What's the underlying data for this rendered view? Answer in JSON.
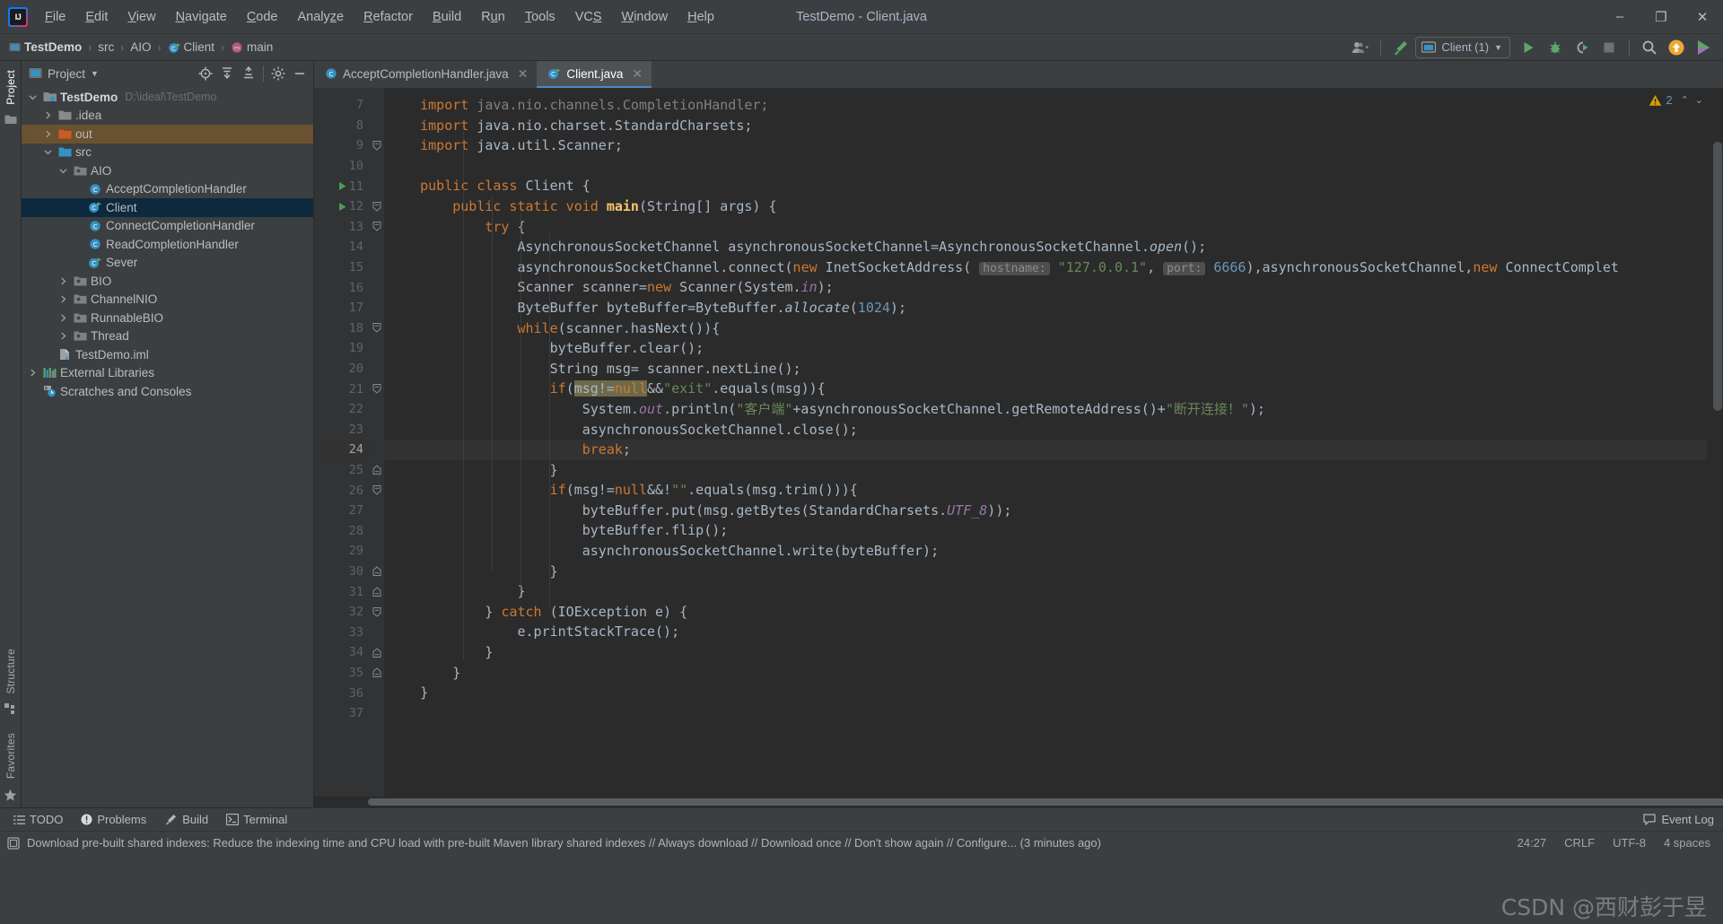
{
  "window": {
    "title": "TestDemo - Client.java",
    "app_icon": "intellij-idea-logo",
    "minimize": "–",
    "maximize": "❐",
    "close": "✕"
  },
  "menubar": [
    {
      "label": "File"
    },
    {
      "label": "Edit"
    },
    {
      "label": "View"
    },
    {
      "label": "Navigate"
    },
    {
      "label": "Code"
    },
    {
      "label": "Analyze"
    },
    {
      "label": "Refactor"
    },
    {
      "label": "Build"
    },
    {
      "label": "Run"
    },
    {
      "label": "Tools"
    },
    {
      "label": "VCS"
    },
    {
      "label": "Window"
    },
    {
      "label": "Help"
    }
  ],
  "breadcrumb": {
    "sep": "›",
    "items": [
      {
        "label": "TestDemo",
        "icon": "project-icon",
        "bold": true
      },
      {
        "label": "src",
        "icon": "folder-icon",
        "bold": false
      },
      {
        "label": "AIO",
        "icon": "package-icon",
        "bold": false
      },
      {
        "label": "Client",
        "icon": "class-icon",
        "bold": false
      },
      {
        "label": "main",
        "icon": "method-icon",
        "bold": false
      }
    ]
  },
  "toolbar": {
    "account_icon": "user-account-icon",
    "build_icon": "build-hammer-icon",
    "run_config": {
      "icon": "run-config-icon",
      "label": "Client (1)",
      "chevron": "▼"
    },
    "run_icon": "run-play-icon",
    "debug_icon": "debug-bug-icon",
    "run_coverage_icon": "run-with-coverage-icon",
    "stop_icon": "stop-square-icon",
    "search_icon": "search-everywhere-icon",
    "update_icon": "update-project-icon",
    "plugin_icon": "plugin-rainbow-icon"
  },
  "tool_strip": {
    "left_top": [
      {
        "label": "Project",
        "icon": "project-tool-icon",
        "active": true
      }
    ],
    "left_bottom": [
      {
        "label": "Structure",
        "icon": "structure-tool-icon",
        "active": false
      },
      {
        "label": "Favorites",
        "icon": "favorites-star-icon",
        "active": false
      }
    ]
  },
  "project_panel": {
    "title": "Project",
    "title_chevron": "▼",
    "icon": "project-view-icon",
    "actions": [
      {
        "name": "locate-icon",
        "glyph": "⊕"
      },
      {
        "name": "expand-all-icon",
        "glyph": "↧"
      },
      {
        "name": "collapse-all-icon",
        "glyph": "↥"
      },
      {
        "name": "settings-gear-icon",
        "glyph": "⚙"
      },
      {
        "name": "hide-panel-icon",
        "glyph": "–"
      }
    ],
    "tree": [
      {
        "label": "TestDemo",
        "sub": "D:\\ideal\\TestDemo",
        "indent": 0,
        "arrow": "down",
        "icon": "project-root-icon",
        "bold": true,
        "state": "normal"
      },
      {
        "label": ".idea",
        "sub": "",
        "indent": 1,
        "arrow": "right",
        "icon": "folder-icon",
        "bold": false,
        "state": "normal"
      },
      {
        "label": "out",
        "sub": "",
        "indent": 1,
        "arrow": "right",
        "icon": "folder-excluded-icon",
        "bold": false,
        "state": "highlight"
      },
      {
        "label": "src",
        "sub": "",
        "indent": 1,
        "arrow": "down",
        "icon": "source-folder-icon",
        "bold": false,
        "state": "normal"
      },
      {
        "label": "AIO",
        "sub": "",
        "indent": 2,
        "arrow": "down",
        "icon": "package-icon",
        "bold": false,
        "state": "normal"
      },
      {
        "label": "AcceptCompletionHandler",
        "sub": "",
        "indent": 3,
        "arrow": "none",
        "icon": "class-icon",
        "bold": false,
        "state": "normal"
      },
      {
        "label": "Client",
        "sub": "",
        "indent": 3,
        "arrow": "none",
        "icon": "runnable-class-icon",
        "bold": false,
        "state": "selected"
      },
      {
        "label": "ConnectCompletionHandler",
        "sub": "",
        "indent": 3,
        "arrow": "none",
        "icon": "class-icon",
        "bold": false,
        "state": "normal"
      },
      {
        "label": "ReadCompletionHandler",
        "sub": "",
        "indent": 3,
        "arrow": "none",
        "icon": "class-icon",
        "bold": false,
        "state": "normal"
      },
      {
        "label": "Sever",
        "sub": "",
        "indent": 3,
        "arrow": "none",
        "icon": "runnable-class-icon",
        "bold": false,
        "state": "normal"
      },
      {
        "label": "BIO",
        "sub": "",
        "indent": 2,
        "arrow": "right",
        "icon": "package-icon",
        "bold": false,
        "state": "normal"
      },
      {
        "label": "ChannelNIO",
        "sub": "",
        "indent": 2,
        "arrow": "right",
        "icon": "package-icon",
        "bold": false,
        "state": "normal"
      },
      {
        "label": "RunnableBIO",
        "sub": "",
        "indent": 2,
        "arrow": "right",
        "icon": "package-icon",
        "bold": false,
        "state": "normal"
      },
      {
        "label": "Thread",
        "sub": "",
        "indent": 2,
        "arrow": "right",
        "icon": "package-icon",
        "bold": false,
        "state": "normal"
      },
      {
        "label": "TestDemo.iml",
        "sub": "",
        "indent": 1,
        "arrow": "none",
        "icon": "iml-file-icon",
        "bold": false,
        "state": "normal"
      },
      {
        "label": "External Libraries",
        "sub": "",
        "indent": 0,
        "arrow": "right",
        "icon": "library-icon",
        "bold": false,
        "state": "normal"
      },
      {
        "label": "Scratches and Consoles",
        "sub": "",
        "indent": 0,
        "arrow": "none",
        "icon": "scratches-icon",
        "bold": false,
        "state": "normal"
      }
    ]
  },
  "editor": {
    "tabs": [
      {
        "label": "AcceptCompletionHandler.java",
        "icon": "class-icon",
        "active": false,
        "close": "✕"
      },
      {
        "label": "Client.java",
        "icon": "runnable-class-icon",
        "active": true,
        "close": "✕"
      }
    ],
    "inspection": {
      "icon": "warning-triangle-icon",
      "count": "2",
      "up": "⌃",
      "down": "⌄"
    },
    "first_line_number": 7,
    "current_line": 24,
    "lines": [
      {
        "n": 7,
        "run": false,
        "fold": "",
        "code": "    <span class='kw'>import</span> <span class='cmt'>java.nio.channels.CompletionHandler;</span>"
      },
      {
        "n": 8,
        "run": false,
        "fold": "",
        "code": "    <span class='kw'>import</span> <span class='plain'>java.nio.charset.StandardCharsets;</span>"
      },
      {
        "n": 9,
        "run": false,
        "fold": "minus",
        "code": "    <span class='kw'>import</span> <span class='plain'>java.util.Scanner;</span>"
      },
      {
        "n": 10,
        "run": false,
        "fold": "",
        "code": ""
      },
      {
        "n": 11,
        "run": true,
        "fold": "",
        "code": "    <span class='kw'>public class</span> <span class='plain'>Client {</span>"
      },
      {
        "n": 12,
        "run": true,
        "fold": "minus",
        "code": "        <span class='kw'>public static void</span> <span class='mth bold-main'>main</span><span class='plain'>(String[] args) {</span>"
      },
      {
        "n": 13,
        "run": false,
        "fold": "minus",
        "code": "            <span class='kw'>try</span> <span class='plain'>{</span>"
      },
      {
        "n": 14,
        "run": false,
        "fold": "",
        "code": "                <span class='plain'>AsynchronousSocketChannel asynchronousSocketChannel=AsynchronousSocketChannel.</span><span class='stc'>open</span><span class='plain'>();</span>"
      },
      {
        "n": 15,
        "run": false,
        "fold": "",
        "code": "                <span class='plain'>asynchronousSocketChannel.connect(</span><span class='kw'>new</span> <span class='plain'>InetSocketAddress(</span> <span class='hintbox'>hostname:</span> <span class='str'>\"127.0.0.1\"</span><span class='plain'>,</span> <span class='hintbox'>port:</span> <span class='num'>6666</span><span class='plain'>),asynchronousSocketChannel,</span><span class='kw'>new</span> <span class='plain'>ConnectComplet</span>"
      },
      {
        "n": 16,
        "run": false,
        "fold": "",
        "code": "                <span class='plain'>Scanner scanner=</span><span class='kw'>new</span> <span class='plain'>Scanner(System.</span><span class='fld'>in</span><span class='plain'>);</span>"
      },
      {
        "n": 17,
        "run": false,
        "fold": "",
        "code": "                <span class='plain'>ByteBuffer byteBuffer=ByteBuffer.</span><span class='stc'>allocate</span><span class='plain'>(</span><span class='num'>1024</span><span class='plain'>);</span>"
      },
      {
        "n": 18,
        "run": false,
        "fold": "minus",
        "code": "                <span class='kw'>while</span><span class='plain'>(scanner.hasNext()){</span>"
      },
      {
        "n": 19,
        "run": false,
        "fold": "",
        "code": "                    <span class='plain'>byteBuffer.clear();</span>"
      },
      {
        "n": 20,
        "run": false,
        "fold": "",
        "code": "                    <span class='plain'>String msg= scanner.nextLine();</span>"
      },
      {
        "n": 21,
        "run": false,
        "fold": "minus",
        "code": "                    <span class='kw'>if</span><span class='plain'>(</span><span class='selhl'>msg!=<span class='kw'>null</span></span><span class='plain'>&amp;&amp;</span><span class='str'>\"exit\"</span><span class='plain'>.equals(msg)){</span>"
      },
      {
        "n": 22,
        "run": false,
        "fold": "",
        "code": "                        <span class='plain'>System.</span><span class='fld'>out</span><span class='plain'>.println(</span><span class='str'>\"客户端\"</span><span class='plain'>+asynchronousSocketChannel.getRemoteAddress()+</span><span class='str'>\"断开连接！\"</span><span class='plain'>);</span>"
      },
      {
        "n": 23,
        "run": false,
        "fold": "",
        "code": "                        <span class='plain'>asynchronousSocketChannel.close();</span>"
      },
      {
        "n": 24,
        "run": false,
        "fold": "",
        "code": "                        <span class='kw'>break</span><span class='plain'>;</span>"
      },
      {
        "n": 25,
        "run": false,
        "fold": "plus",
        "code": "                    <span class='plain'>}</span>"
      },
      {
        "n": 26,
        "run": false,
        "fold": "minus",
        "code": "                    <span class='kw'>if</span><span class='plain'>(msg!=</span><span class='kw'>null</span><span class='plain'>&amp;&amp;!</span><span class='str'>\"\"</span><span class='plain'>.equals(msg.trim())){</span>"
      },
      {
        "n": 27,
        "run": false,
        "fold": "",
        "code": "                        <span class='plain'>byteBuffer.put(msg.getBytes(StandardCharsets.</span><span class='fld'>UTF_8</span><span class='plain'>));</span>"
      },
      {
        "n": 28,
        "run": false,
        "fold": "",
        "code": "                        <span class='plain'>byteBuffer.flip();</span>"
      },
      {
        "n": 29,
        "run": false,
        "fold": "",
        "code": "                        <span class='plain'>asynchronousSocketChannel.write(byteBuffer);</span>"
      },
      {
        "n": 30,
        "run": false,
        "fold": "plus",
        "code": "                    <span class='plain'>}</span>"
      },
      {
        "n": 31,
        "run": false,
        "fold": "plus",
        "code": "                <span class='plain'>}</span>"
      },
      {
        "n": 32,
        "run": false,
        "fold": "minus",
        "code": "            <span class='plain'>} </span><span class='kw'>catch</span> <span class='plain'>(IOException e) {</span>"
      },
      {
        "n": 33,
        "run": false,
        "fold": "",
        "code": "                <span class='plain'>e.printStackTrace();</span>"
      },
      {
        "n": 34,
        "run": false,
        "fold": "plus",
        "code": "            <span class='plain'>}</span>"
      },
      {
        "n": 35,
        "run": false,
        "fold": "plus",
        "code": "        <span class='plain'>}</span>"
      },
      {
        "n": 36,
        "run": false,
        "fold": "",
        "code": "    <span class='plain'>}</span>"
      },
      {
        "n": 37,
        "run": false,
        "fold": "",
        "code": ""
      }
    ]
  },
  "bottom_bar": {
    "items": [
      {
        "label": "TODO",
        "icon": "todo-list-icon"
      },
      {
        "label": "Problems",
        "icon": "problems-icon"
      },
      {
        "label": "Build",
        "icon": "build-hammer-icon"
      },
      {
        "label": "Terminal",
        "icon": "terminal-icon"
      }
    ],
    "event_log": {
      "label": "Event Log",
      "icon": "event-log-icon"
    }
  },
  "status_bar": {
    "icon": "notification-icon",
    "message": "Download pre-built shared indexes: Reduce the indexing time and CPU load with pre-built Maven library shared indexes // Always download // Download once // Don't show again // Configure... (3 minutes ago)",
    "caret_position": "24:27",
    "line_separator": "CRLF",
    "encoding": "UTF-8",
    "indent": "4 spaces"
  },
  "watermark": "CSDN @西财彭于昱",
  "colors": {
    "accent_blue": "#4a88c7",
    "selection": "#0d293e",
    "keyword": "#cc7832",
    "string": "#6a8759",
    "number": "#6897bb",
    "field": "#9876aa",
    "method": "#ffc66d",
    "editor_bg": "#2b2b2b",
    "panel_bg": "#3c3f41",
    "warning": "#d6a100"
  }
}
